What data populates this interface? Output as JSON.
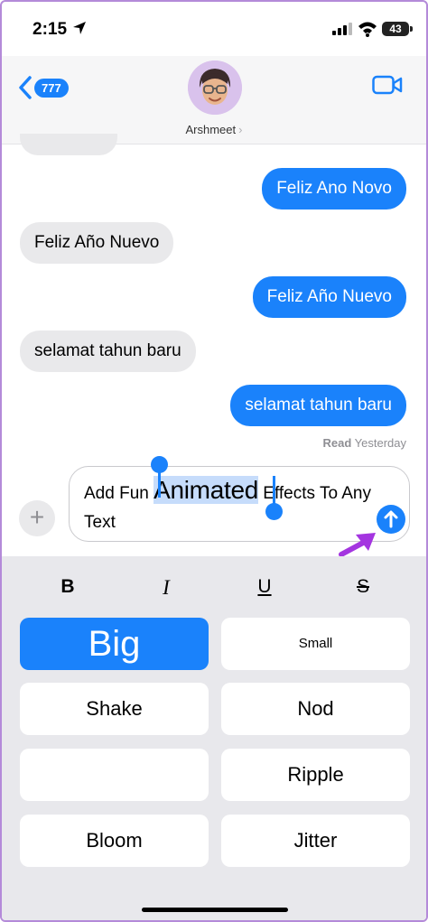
{
  "status": {
    "time": "2:15",
    "battery": "43"
  },
  "nav": {
    "back_badge": "777",
    "contact": "Arshmeet",
    "contact_chevron": "›",
    "icons": {
      "back": "chevron-left-icon",
      "video": "video-camera-icon"
    }
  },
  "messages": [
    {
      "direction": "outgoing",
      "text": "Feliz Ano Novo"
    },
    {
      "direction": "incoming",
      "text": "Feliz Año Nuevo"
    },
    {
      "direction": "outgoing",
      "text": "Feliz Año Nuevo"
    },
    {
      "direction": "incoming",
      "text": "selamat tahun baru"
    },
    {
      "direction": "outgoing",
      "text": "selamat tahun baru"
    }
  ],
  "receipt": {
    "status": "Read",
    "when": "Yesterday"
  },
  "compose": {
    "before": "Add Fun ",
    "selected": "Animated",
    "after": " Effects To Any Text",
    "add_symbol": "+"
  },
  "format": {
    "bold": "B",
    "italic": "I",
    "underline": "U",
    "strike": "S"
  },
  "effects": [
    "Big",
    "Small",
    "Shake",
    "Nod",
    "",
    "Ripple",
    "Bloom",
    "Jitter"
  ],
  "colors": {
    "accent": "#1a82fb",
    "incoming_bubble": "#e9e9eb",
    "annotation": "#a435e0"
  }
}
